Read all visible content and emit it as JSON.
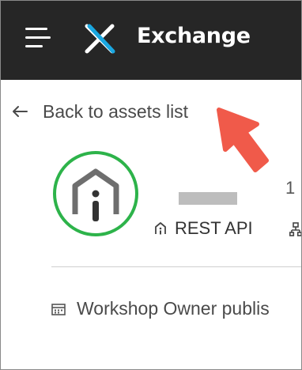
{
  "header": {
    "brand": "Exchange",
    "menu_icon": "hamburger-menu-icon",
    "logo_icon": "exchange-x-logo",
    "background_color": "#262626",
    "text_color": "#ffffff"
  },
  "navigation": {
    "back_label": "Back to assets list",
    "back_icon": "arrow-left-icon"
  },
  "annotation": {
    "icon": "red-pointer-arrow",
    "color": "#f05a4a"
  },
  "asset": {
    "icon": "api-house-icon",
    "icon_ring_color": "#2db34a",
    "name": "",
    "type_label": "REST API",
    "type_icon": "api-type-icon",
    "org_icon": "organization-icon",
    "right_cut_text": "1"
  },
  "publisher": {
    "icon": "calendar-icon",
    "text": "Workshop Owner publis"
  }
}
